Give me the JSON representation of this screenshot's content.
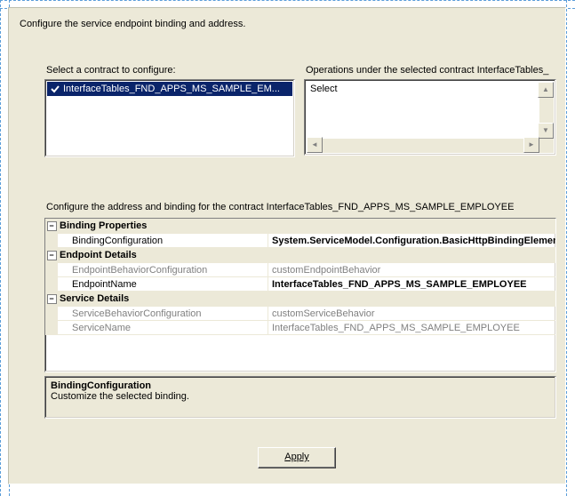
{
  "instruction": "Configure the service endpoint binding and address.",
  "contract_label": "Select a contract to configure:",
  "operations_label": "Operations under the selected contract  InterfaceTables_",
  "contract_item": "InterfaceTables_FND_APPS_MS_SAMPLE_EM...",
  "operations_item": "Select",
  "configure_address_label": "Configure the address and binding for the contract  InterfaceTables_FND_APPS_MS_SAMPLE_EMPLOYEE",
  "propgrid": {
    "cat1": "Binding Properties",
    "binding_config_label": "BindingConfiguration",
    "binding_config_value": "System.ServiceModel.Configuration.BasicHttpBindingElement",
    "cat2": "Endpoint Details",
    "endpoint_behavior_label": "EndpointBehaviorConfiguration",
    "endpoint_behavior_value": "customEndpointBehavior",
    "endpoint_name_label": "EndpointName",
    "endpoint_name_value": "InterfaceTables_FND_APPS_MS_SAMPLE_EMPLOYEE",
    "cat3": "Service Details",
    "service_behavior_label": "ServiceBehaviorConfiguration",
    "service_behavior_value": "customServiceBehavior",
    "service_name_label": "ServiceName",
    "service_name_value": "InterfaceTables_FND_APPS_MS_SAMPLE_EMPLOYEE"
  },
  "description_title": "BindingConfiguration",
  "description_text": "Customize the selected binding.",
  "apply_label": "Apply"
}
